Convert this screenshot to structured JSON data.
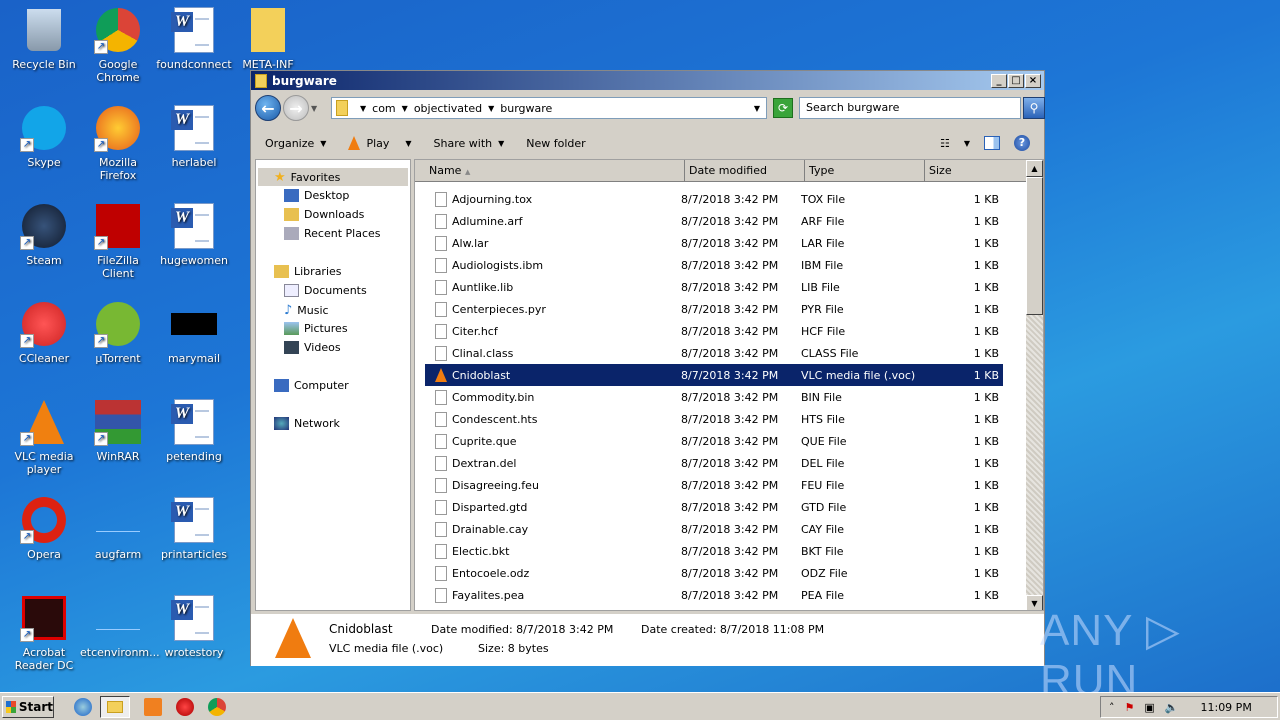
{
  "desktop": {
    "icons": [
      {
        "label": "Recycle Bin",
        "icon": "recycle-bin-icon"
      },
      {
        "label": "Google Chrome",
        "icon": "chrome-icon"
      },
      {
        "label": "foundconnect",
        "icon": "word-doc-icon"
      },
      {
        "label": "META-INF",
        "icon": "folder-icon"
      },
      {
        "label": "Skype",
        "icon": "skype-icon"
      },
      {
        "label": "Mozilla Firefox",
        "icon": "firefox-icon"
      },
      {
        "label": "herlabel",
        "icon": "word-doc-icon"
      },
      {
        "label": "Steam",
        "icon": "steam-icon"
      },
      {
        "label": "FileZilla Client",
        "icon": "filezilla-icon"
      },
      {
        "label": "hugewomen",
        "icon": "word-doc-icon"
      },
      {
        "label": "CCleaner",
        "icon": "ccleaner-icon"
      },
      {
        "label": "µTorrent",
        "icon": "utorrent-icon"
      },
      {
        "label": "marymail",
        "icon": "black-thumbnail-icon"
      },
      {
        "label": "VLC media player",
        "icon": "vlc-icon"
      },
      {
        "label": "WinRAR",
        "icon": "winrar-icon"
      },
      {
        "label": "petending",
        "icon": "word-doc-icon"
      },
      {
        "label": "Opera",
        "icon": "opera-icon"
      },
      {
        "label": "augfarm",
        "icon": "blank-file-icon"
      },
      {
        "label": "printarticles",
        "icon": "word-doc-icon"
      },
      {
        "label": "Acrobat Reader DC",
        "icon": "acrobat-icon"
      },
      {
        "label": "etcenvironm...",
        "icon": "blank-file-icon"
      },
      {
        "label": "wrotestory",
        "icon": "word-doc-icon"
      }
    ]
  },
  "window": {
    "title": "burgware",
    "breadcrumb": [
      "com",
      "objectivated",
      "burgware"
    ],
    "search_placeholder": "Search burgware",
    "toolbar": {
      "organize": "Organize",
      "play": "Play",
      "share": "Share with",
      "new_folder": "New folder"
    },
    "nav": {
      "favorites": "Favorites",
      "desktop": "Desktop",
      "downloads": "Downloads",
      "recent": "Recent Places",
      "libraries": "Libraries",
      "documents": "Documents",
      "music": "Music",
      "pictures": "Pictures",
      "videos": "Videos",
      "computer": "Computer",
      "network": "Network"
    },
    "columns": {
      "name": "Name",
      "date": "Date modified",
      "type": "Type",
      "size": "Size"
    },
    "files": [
      {
        "name": "Adjourning.tox",
        "date": "8/7/2018 3:42 PM",
        "type": "TOX File",
        "size": "1 KB"
      },
      {
        "name": "Adlumine.arf",
        "date": "8/7/2018 3:42 PM",
        "type": "ARF File",
        "size": "1 KB"
      },
      {
        "name": "Alw.lar",
        "date": "8/7/2018 3:42 PM",
        "type": "LAR File",
        "size": "1 KB"
      },
      {
        "name": "Audiologists.ibm",
        "date": "8/7/2018 3:42 PM",
        "type": "IBM File",
        "size": "1 KB"
      },
      {
        "name": "Auntlike.lib",
        "date": "8/7/2018 3:42 PM",
        "type": "LIB File",
        "size": "1 KB"
      },
      {
        "name": "Centerpieces.pyr",
        "date": "8/7/2018 3:42 PM",
        "type": "PYR File",
        "size": "1 KB"
      },
      {
        "name": "Citer.hcf",
        "date": "8/7/2018 3:42 PM",
        "type": "HCF File",
        "size": "1 KB"
      },
      {
        "name": "Clinal.class",
        "date": "8/7/2018 3:42 PM",
        "type": "CLASS File",
        "size": "1 KB"
      },
      {
        "name": "Cnidoblast",
        "date": "8/7/2018 3:42 PM",
        "type": "VLC media file (.voc)",
        "size": "1 KB",
        "selected": true
      },
      {
        "name": "Commodity.bin",
        "date": "8/7/2018 3:42 PM",
        "type": "BIN File",
        "size": "1 KB"
      },
      {
        "name": "Condescent.hts",
        "date": "8/7/2018 3:42 PM",
        "type": "HTS File",
        "size": "1 KB"
      },
      {
        "name": "Cuprite.que",
        "date": "8/7/2018 3:42 PM",
        "type": "QUE File",
        "size": "1 KB"
      },
      {
        "name": "Dextran.del",
        "date": "8/7/2018 3:42 PM",
        "type": "DEL File",
        "size": "1 KB"
      },
      {
        "name": "Disagreeing.feu",
        "date": "8/7/2018 3:42 PM",
        "type": "FEU File",
        "size": "1 KB"
      },
      {
        "name": "Disparted.gtd",
        "date": "8/7/2018 3:42 PM",
        "type": "GTD File",
        "size": "1 KB"
      },
      {
        "name": "Drainable.cay",
        "date": "8/7/2018 3:42 PM",
        "type": "CAY File",
        "size": "1 KB"
      },
      {
        "name": "Electic.bkt",
        "date": "8/7/2018 3:42 PM",
        "type": "BKT File",
        "size": "1 KB"
      },
      {
        "name": "Entocoele.odz",
        "date": "8/7/2018 3:42 PM",
        "type": "ODZ File",
        "size": "1 KB"
      },
      {
        "name": "Fayalites.pea",
        "date": "8/7/2018 3:42 PM",
        "type": "PEA File",
        "size": "1 KB"
      }
    ],
    "details": {
      "name": "Cnidoblast",
      "type": "VLC media file (.voc)",
      "modified": "Date modified: 8/7/2018 3:42 PM",
      "created": "Date created: 8/7/2018 11:08 PM",
      "size": "Size: 8 bytes"
    }
  },
  "taskbar": {
    "start": "Start",
    "clock": "11:09 PM"
  },
  "watermark": "ANY ▷ RUN",
  "colors": {
    "selection": "#0a246a",
    "accent": "#1a62c8"
  }
}
